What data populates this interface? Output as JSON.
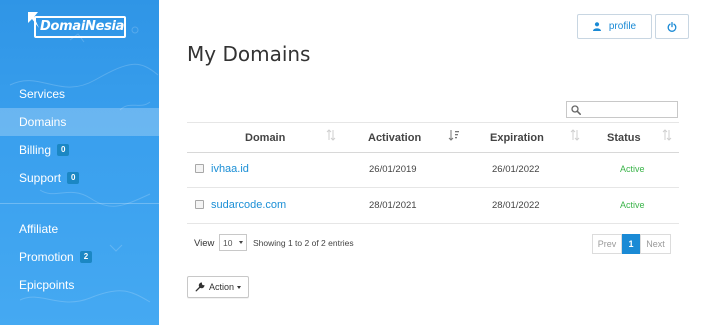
{
  "brand": {
    "logo_text": "DomaiNesia"
  },
  "sidebar": {
    "items": [
      {
        "label": "Services",
        "badge": ""
      },
      {
        "label": "Domains",
        "badge": "",
        "active": true
      },
      {
        "label": "Billing",
        "badge": "0"
      },
      {
        "label": "Support",
        "badge": "0"
      }
    ],
    "items2": [
      {
        "label": "Affiliate",
        "badge": ""
      },
      {
        "label": "Promotion",
        "badge": "2"
      },
      {
        "label": "Epicpoints",
        "badge": ""
      }
    ]
  },
  "header": {
    "profile_label": "profile",
    "title": "My Domains"
  },
  "search": {
    "placeholder": "",
    "value": ""
  },
  "table": {
    "columns": [
      "Domain",
      "Activation",
      "Expiration",
      "Status"
    ],
    "rows": [
      {
        "domain": "ivhaa.id",
        "activation": "26/01/2019",
        "expiration": "26/01/2022",
        "status": "Active"
      },
      {
        "domain": "sudarcode.com",
        "activation": "28/01/2021",
        "expiration": "28/01/2022",
        "status": "Active"
      }
    ]
  },
  "footer": {
    "view_label": "View",
    "page_size": "10",
    "entries_text": "Showing 1 to 2 of 2 entries",
    "pager": {
      "prev": "Prev",
      "current": "1",
      "next": "Next"
    }
  },
  "action": {
    "label": "Action"
  },
  "colors": {
    "accent": "#1a8ad5",
    "sidebar": "#3aa0ee",
    "status_active": "#3bb44a"
  }
}
